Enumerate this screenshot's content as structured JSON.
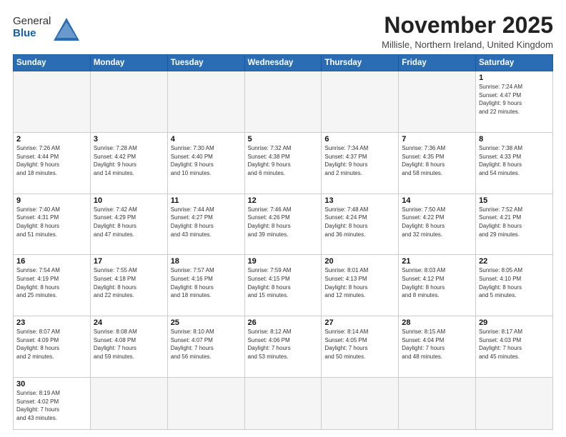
{
  "header": {
    "logo_general": "General",
    "logo_blue": "Blue",
    "month_title": "November 2025",
    "location": "Millisle, Northern Ireland, United Kingdom"
  },
  "days_of_week": [
    "Sunday",
    "Monday",
    "Tuesday",
    "Wednesday",
    "Thursday",
    "Friday",
    "Saturday"
  ],
  "weeks": [
    [
      {
        "num": "",
        "info": ""
      },
      {
        "num": "",
        "info": ""
      },
      {
        "num": "",
        "info": ""
      },
      {
        "num": "",
        "info": ""
      },
      {
        "num": "",
        "info": ""
      },
      {
        "num": "",
        "info": ""
      },
      {
        "num": "1",
        "info": "Sunrise: 7:24 AM\nSunset: 4:47 PM\nDaylight: 9 hours\nand 22 minutes."
      }
    ],
    [
      {
        "num": "2",
        "info": "Sunrise: 7:26 AM\nSunset: 4:44 PM\nDaylight: 9 hours\nand 18 minutes."
      },
      {
        "num": "3",
        "info": "Sunrise: 7:28 AM\nSunset: 4:42 PM\nDaylight: 9 hours\nand 14 minutes."
      },
      {
        "num": "4",
        "info": "Sunrise: 7:30 AM\nSunset: 4:40 PM\nDaylight: 9 hours\nand 10 minutes."
      },
      {
        "num": "5",
        "info": "Sunrise: 7:32 AM\nSunset: 4:38 PM\nDaylight: 9 hours\nand 6 minutes."
      },
      {
        "num": "6",
        "info": "Sunrise: 7:34 AM\nSunset: 4:37 PM\nDaylight: 9 hours\nand 2 minutes."
      },
      {
        "num": "7",
        "info": "Sunrise: 7:36 AM\nSunset: 4:35 PM\nDaylight: 8 hours\nand 58 minutes."
      },
      {
        "num": "8",
        "info": "Sunrise: 7:38 AM\nSunset: 4:33 PM\nDaylight: 8 hours\nand 54 minutes."
      }
    ],
    [
      {
        "num": "9",
        "info": "Sunrise: 7:40 AM\nSunset: 4:31 PM\nDaylight: 8 hours\nand 51 minutes."
      },
      {
        "num": "10",
        "info": "Sunrise: 7:42 AM\nSunset: 4:29 PM\nDaylight: 8 hours\nand 47 minutes."
      },
      {
        "num": "11",
        "info": "Sunrise: 7:44 AM\nSunset: 4:27 PM\nDaylight: 8 hours\nand 43 minutes."
      },
      {
        "num": "12",
        "info": "Sunrise: 7:46 AM\nSunset: 4:26 PM\nDaylight: 8 hours\nand 39 minutes."
      },
      {
        "num": "13",
        "info": "Sunrise: 7:48 AM\nSunset: 4:24 PM\nDaylight: 8 hours\nand 36 minutes."
      },
      {
        "num": "14",
        "info": "Sunrise: 7:50 AM\nSunset: 4:22 PM\nDaylight: 8 hours\nand 32 minutes."
      },
      {
        "num": "15",
        "info": "Sunrise: 7:52 AM\nSunset: 4:21 PM\nDaylight: 8 hours\nand 29 minutes."
      }
    ],
    [
      {
        "num": "16",
        "info": "Sunrise: 7:54 AM\nSunset: 4:19 PM\nDaylight: 8 hours\nand 25 minutes."
      },
      {
        "num": "17",
        "info": "Sunrise: 7:55 AM\nSunset: 4:18 PM\nDaylight: 8 hours\nand 22 minutes."
      },
      {
        "num": "18",
        "info": "Sunrise: 7:57 AM\nSunset: 4:16 PM\nDaylight: 8 hours\nand 18 minutes."
      },
      {
        "num": "19",
        "info": "Sunrise: 7:59 AM\nSunset: 4:15 PM\nDaylight: 8 hours\nand 15 minutes."
      },
      {
        "num": "20",
        "info": "Sunrise: 8:01 AM\nSunset: 4:13 PM\nDaylight: 8 hours\nand 12 minutes."
      },
      {
        "num": "21",
        "info": "Sunrise: 8:03 AM\nSunset: 4:12 PM\nDaylight: 8 hours\nand 8 minutes."
      },
      {
        "num": "22",
        "info": "Sunrise: 8:05 AM\nSunset: 4:10 PM\nDaylight: 8 hours\nand 5 minutes."
      }
    ],
    [
      {
        "num": "23",
        "info": "Sunrise: 8:07 AM\nSunset: 4:09 PM\nDaylight: 8 hours\nand 2 minutes."
      },
      {
        "num": "24",
        "info": "Sunrise: 8:08 AM\nSunset: 4:08 PM\nDaylight: 7 hours\nand 59 minutes."
      },
      {
        "num": "25",
        "info": "Sunrise: 8:10 AM\nSunset: 4:07 PM\nDaylight: 7 hours\nand 56 minutes."
      },
      {
        "num": "26",
        "info": "Sunrise: 8:12 AM\nSunset: 4:06 PM\nDaylight: 7 hours\nand 53 minutes."
      },
      {
        "num": "27",
        "info": "Sunrise: 8:14 AM\nSunset: 4:05 PM\nDaylight: 7 hours\nand 50 minutes."
      },
      {
        "num": "28",
        "info": "Sunrise: 8:15 AM\nSunset: 4:04 PM\nDaylight: 7 hours\nand 48 minutes."
      },
      {
        "num": "29",
        "info": "Sunrise: 8:17 AM\nSunset: 4:03 PM\nDaylight: 7 hours\nand 45 minutes."
      }
    ],
    [
      {
        "num": "30",
        "info": "Sunrise: 8:19 AM\nSunset: 4:02 PM\nDaylight: 7 hours\nand 43 minutes."
      },
      {
        "num": "",
        "info": ""
      },
      {
        "num": "",
        "info": ""
      },
      {
        "num": "",
        "info": ""
      },
      {
        "num": "",
        "info": ""
      },
      {
        "num": "",
        "info": ""
      },
      {
        "num": "",
        "info": ""
      }
    ]
  ]
}
